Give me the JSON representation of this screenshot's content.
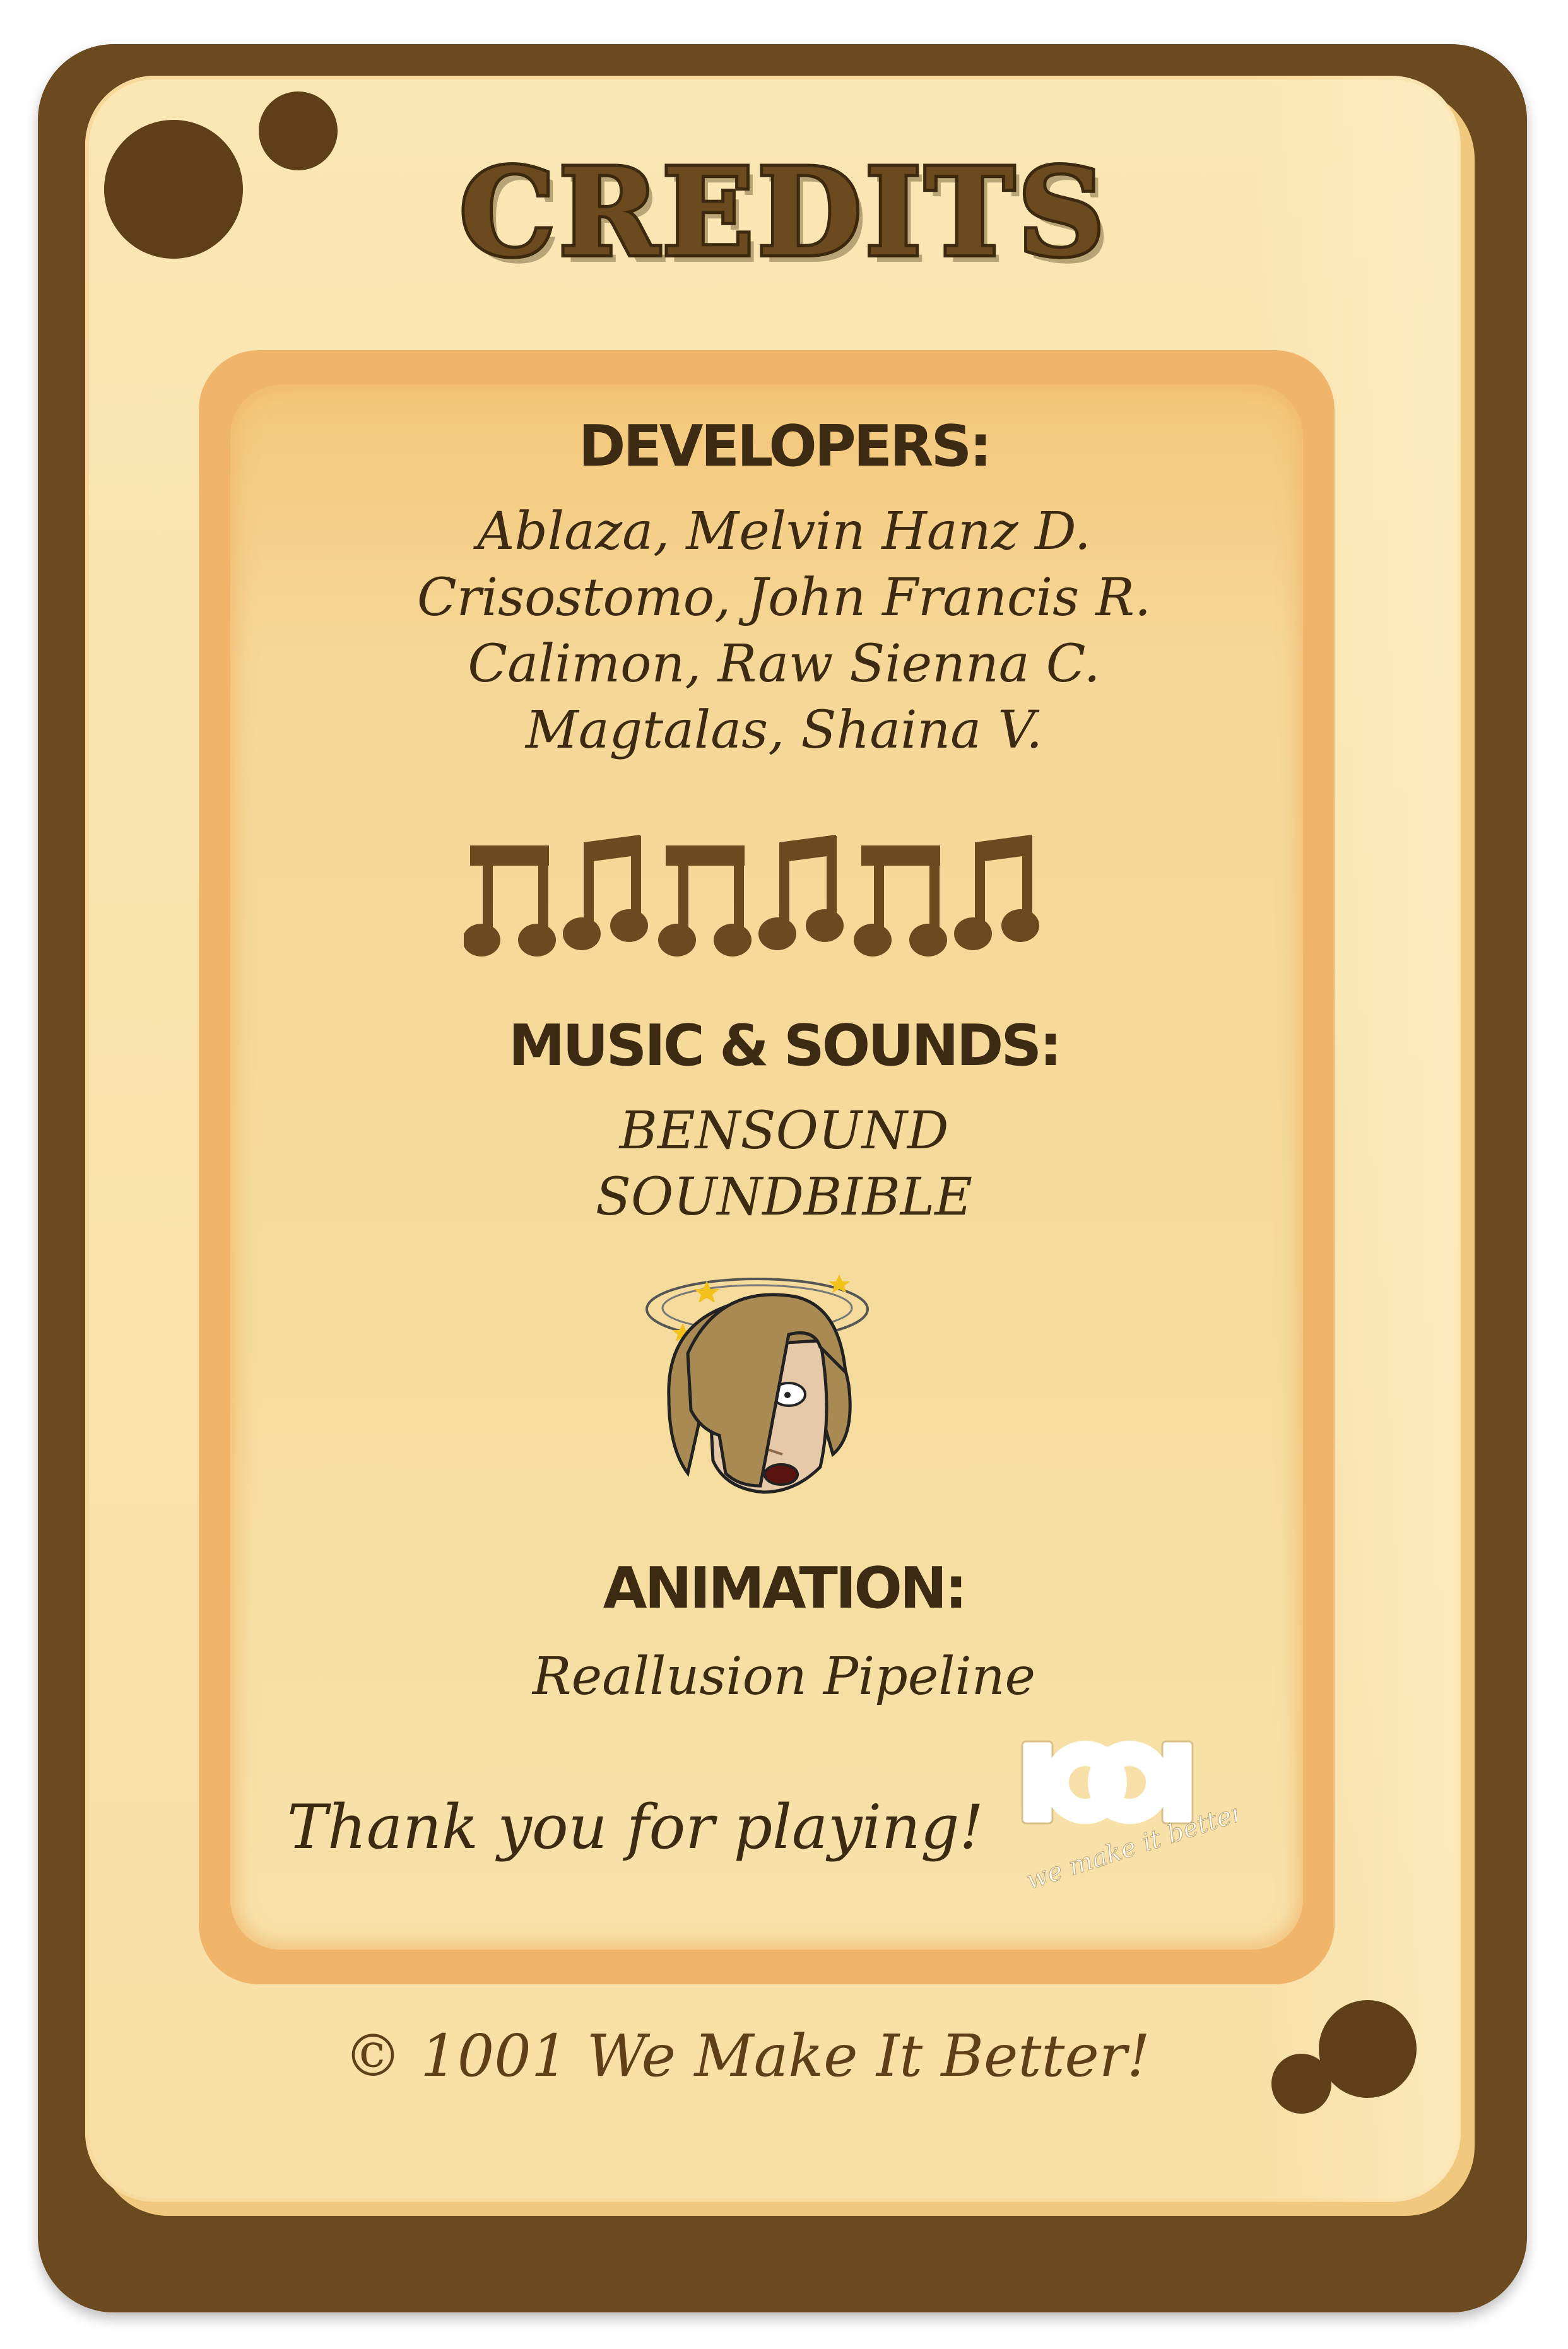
{
  "title": "CREDITS",
  "sections": {
    "developers": {
      "heading": "DEVELOPERS:",
      "names": [
        "Ablaza, Melvin Hanz D.",
        "Crisostomo, John Francis R.",
        "Calimon, Raw Sienna C.",
        "Magtalas, Shaina V."
      ]
    },
    "music": {
      "heading": "MUSIC & SOUNDS:",
      "names": [
        "BENSOUND",
        "SOUNDBIBLE"
      ]
    },
    "animation": {
      "heading": "ANIMATION:",
      "names": [
        "Reallusion Pipeline"
      ]
    }
  },
  "thanks": "Thank you for playing!",
  "logo": {
    "mark": "1001",
    "tagline": "we make it better!"
  },
  "copyright": "© 1001 We Make It Better!",
  "icons": {
    "music_notes": "music-notes-icon",
    "dizzy_character": "dizzy-character-icon"
  },
  "colors": {
    "frame": "#6b4a1f",
    "card": "#fbe7b4",
    "panel": "#f0b56a",
    "text": "#3c2a12"
  }
}
